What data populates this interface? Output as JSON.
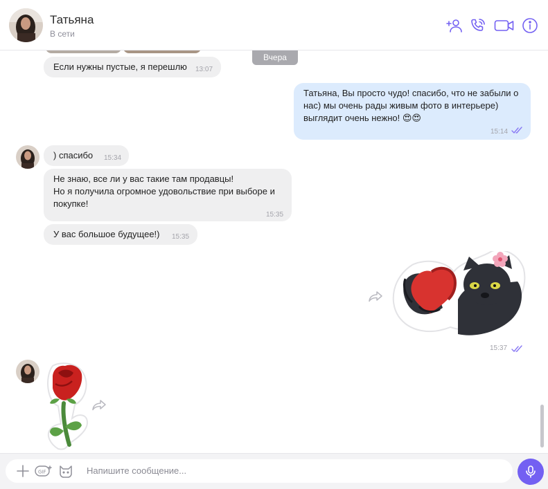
{
  "header": {
    "name": "Татьяна",
    "status": "В сети"
  },
  "chat": {
    "day_label": "Вчера",
    "messages": [
      {
        "text": "Если нужны пустые, я перешлю",
        "time": "13:07"
      },
      {
        "text": "Татьяна, Вы просто чудо! спасибо, что не забыли о нас) мы очень рады живым фото в интерьере) выглядит очень нежно! 😍😍",
        "time": "15:14"
      },
      {
        "text": ") спасибо",
        "time": "15:34"
      },
      {
        "text": "Не знаю, все ли у вас такие там продавцы!\nНо я получила огромное удовольствие при выборе и покупке!",
        "time": "15:35"
      },
      {
        "text": "У вас большое будущее!)",
        "time": "15:35"
      },
      {
        "sticker": "panther-heart-sticker",
        "time": "15:37"
      },
      {
        "sticker": "red-rose-sticker"
      }
    ]
  },
  "composer": {
    "placeholder": "Напишите сообщение..."
  },
  "colors": {
    "accent": "#7360f2",
    "incoming_bubble": "#efeff0",
    "outgoing_bubble": "#dcebfd"
  },
  "icons": [
    "add-contact-icon",
    "call-icon",
    "video-icon",
    "info-icon",
    "plus-icon",
    "gif-icon",
    "sticker-icon",
    "mic-icon",
    "share-icon",
    "read-check-icon"
  ]
}
